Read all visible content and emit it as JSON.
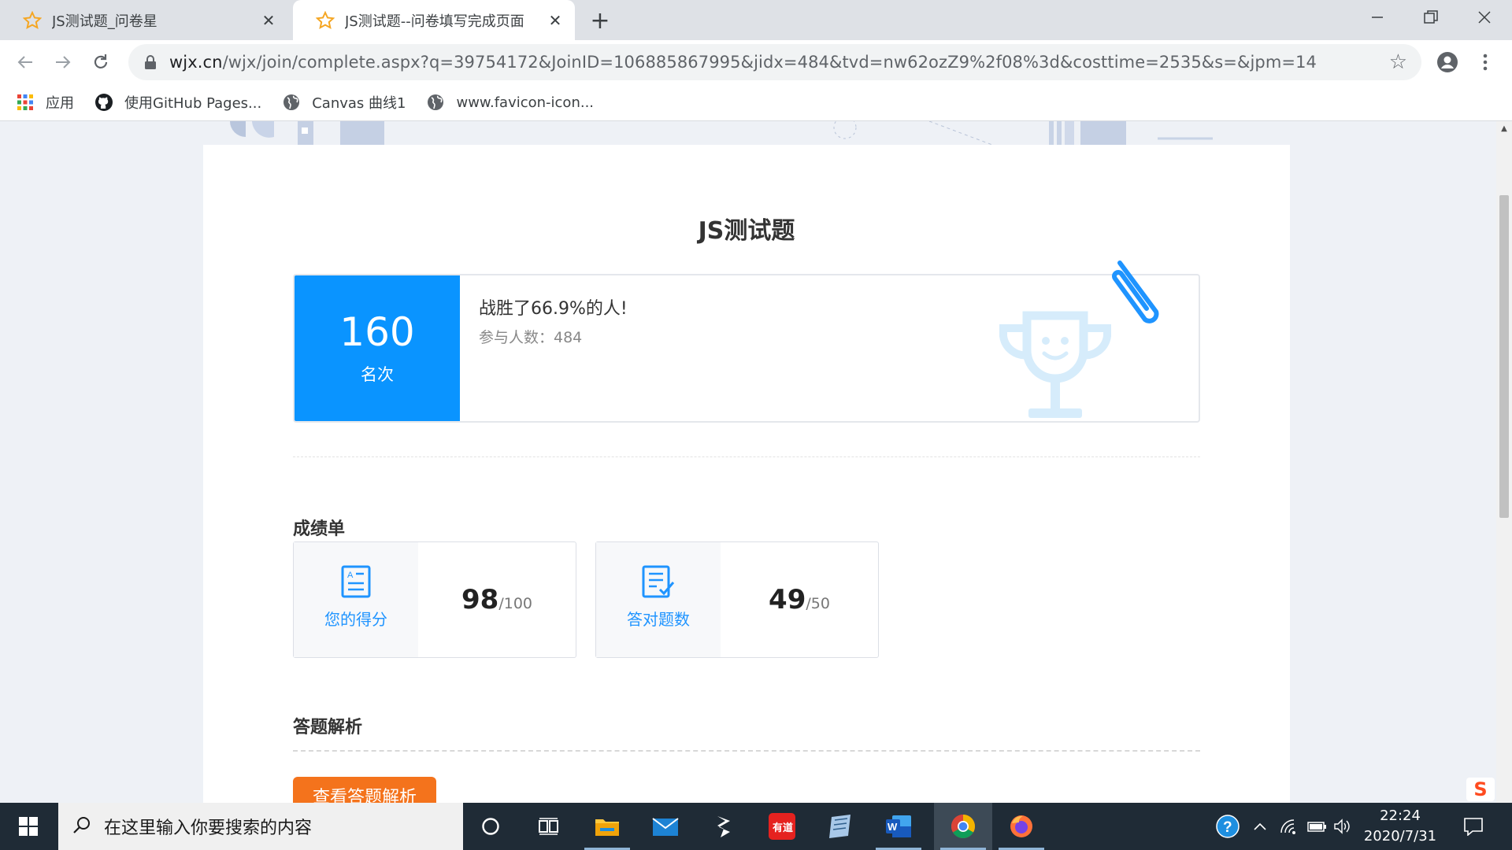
{
  "browser": {
    "tabs": [
      {
        "title": "JS测试题_问卷星",
        "active": false
      },
      {
        "title": "JS测试题--问卷填写完成页面",
        "active": true
      }
    ],
    "new_tab": "+",
    "url_host": "wjx.cn",
    "url_path": "/wjx/join/complete.aspx?q=39754172&JoinID=106885867995&jidx=484&tvd=nw62ozZ9%2f08%3d&costtime=2535&s=&jpm=14",
    "bookmarks": [
      {
        "label": "应用",
        "icon": "apps-grid-icon"
      },
      {
        "label": "使用GitHub Pages...",
        "icon": "github-icon"
      },
      {
        "label": "Canvas 曲线1",
        "icon": "globe-icon"
      },
      {
        "label": "www.favicon-icon...",
        "icon": "globe-icon"
      }
    ]
  },
  "page": {
    "title": "JS测试题",
    "rank": {
      "value": "160",
      "label": "名次"
    },
    "beat_text": "战胜了66.9%的人!",
    "participants_text": "参与人数：484",
    "scorecard_title": "成绩单",
    "stats": [
      {
        "caption": "您的得分",
        "value": "98",
        "total": "/100",
        "icon": "score-sheet-icon"
      },
      {
        "caption": "答对题数",
        "value": "49",
        "total": "/50",
        "icon": "checklist-icon"
      }
    ],
    "analysis_title": "答题解析",
    "analysis_button": "查看答题解析"
  },
  "taskbar": {
    "search_placeholder": "在这里输入你要搜索的内容",
    "time": "22:24",
    "date": "2020/7/31"
  },
  "colors": {
    "accent_blue": "#0a94ff",
    "caption_blue": "#1f94ff",
    "button_orange": "#f4731c",
    "taskbar": "#1f2b36"
  }
}
